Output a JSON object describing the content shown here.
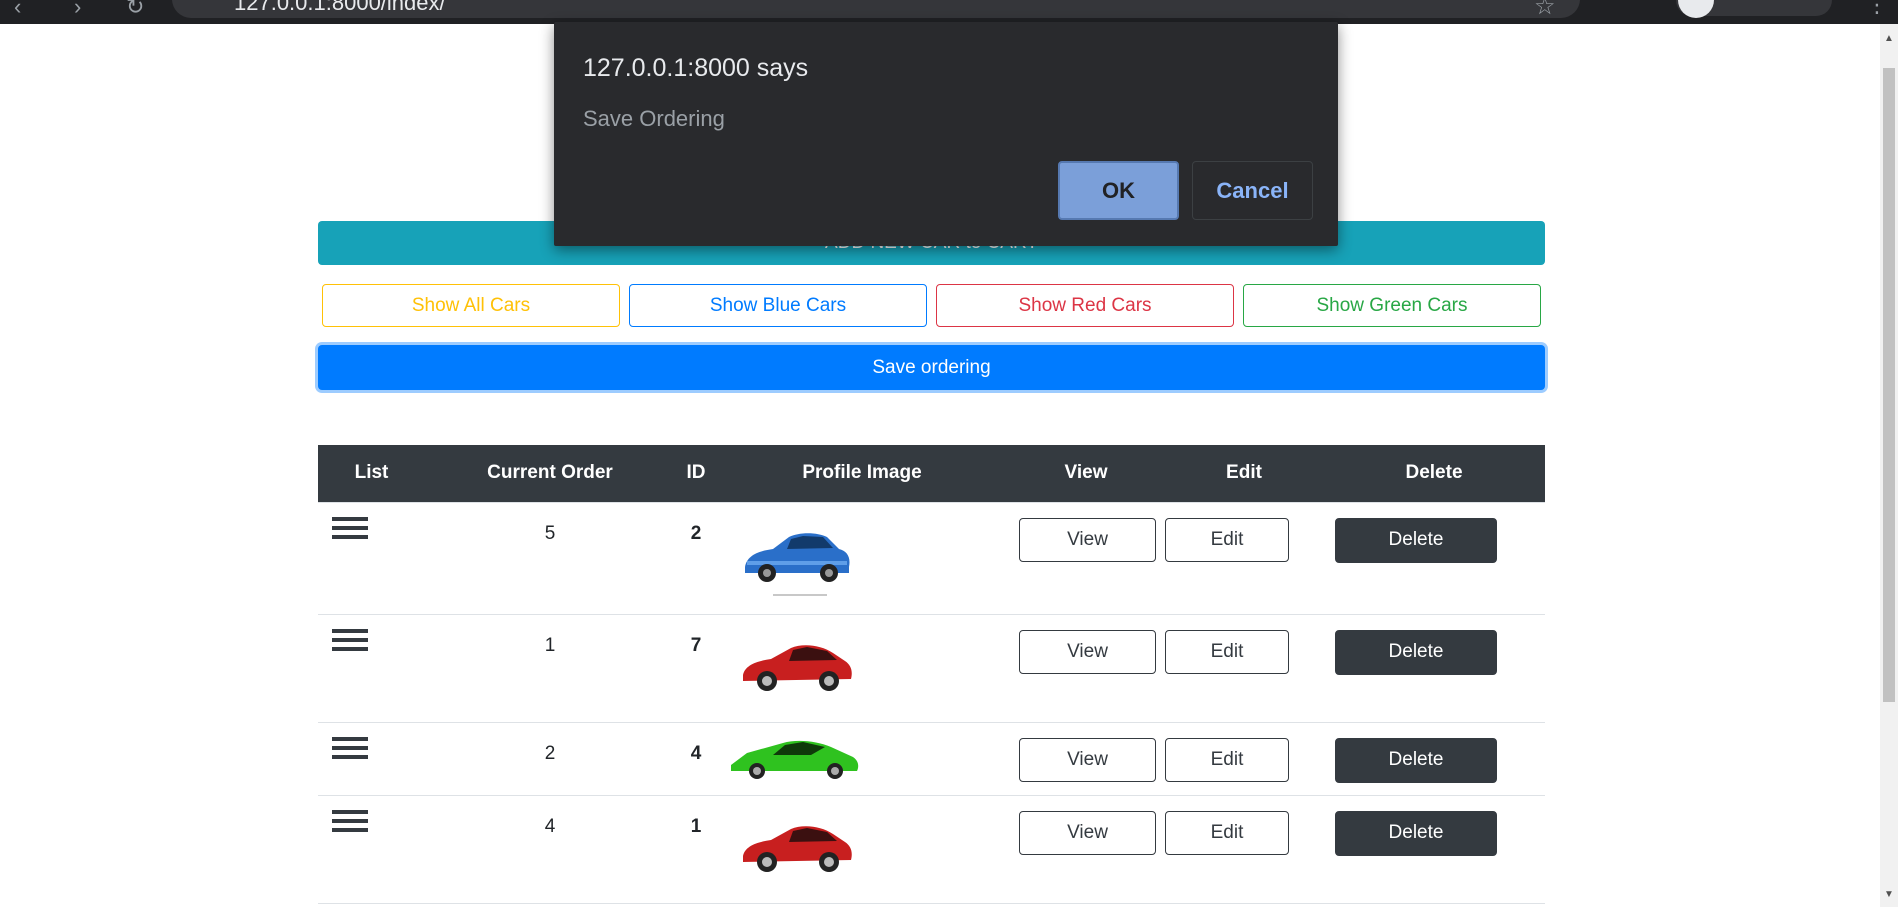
{
  "browser": {
    "url": "127.0.0.1:8000/index/"
  },
  "dialog": {
    "title": "127.0.0.1:8000 says",
    "message": "Save Ordering",
    "ok_label": "OK",
    "cancel_label": "Cancel"
  },
  "page": {
    "add_button_label": "ADD NEW CAR to CART",
    "filters": {
      "all": "Show All Cars",
      "blue": "Show Blue Cars",
      "red": "Show Red Cars",
      "green": "Show Green Cars"
    },
    "save_button_label": "Save ordering"
  },
  "table": {
    "headers": {
      "list": "List",
      "current_order": "Current Order",
      "id": "ID",
      "profile_image": "Profile Image",
      "view": "View",
      "edit": "Edit",
      "delete": "Delete"
    },
    "rows": [
      {
        "current_order": "5",
        "id": "2",
        "car_color": "blue",
        "view": "View",
        "edit": "Edit",
        "delete": "Delete"
      },
      {
        "current_order": "1",
        "id": "7",
        "car_color": "red",
        "view": "View",
        "edit": "Edit",
        "delete": "Delete"
      },
      {
        "current_order": "2",
        "id": "4",
        "car_color": "green",
        "view": "View",
        "edit": "Edit",
        "delete": "Delete"
      },
      {
        "current_order": "4",
        "id": "1",
        "car_color": "red",
        "view": "View",
        "edit": "Edit",
        "delete": "Delete"
      }
    ]
  },
  "colors": {
    "info": "#17a2b8",
    "primary": "#007bff",
    "warning": "#ffc107",
    "danger": "#dc3545",
    "success": "#28a745",
    "dark": "#343a40"
  }
}
